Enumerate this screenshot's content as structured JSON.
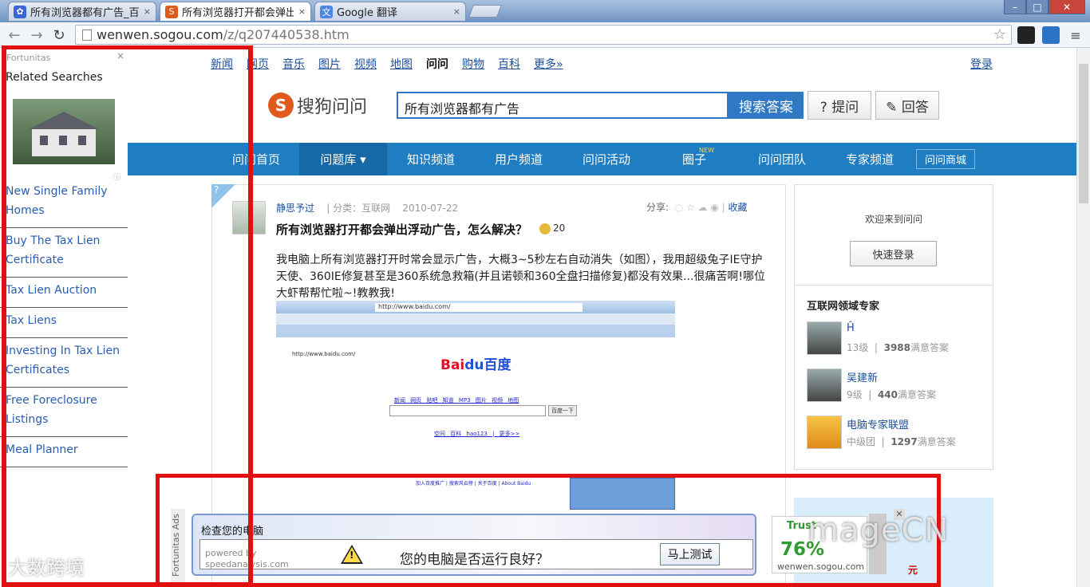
{
  "browser": {
    "tabs": [
      {
        "title": "所有浏览器都有广告_百度",
        "icon": "baidu-paw-icon",
        "close": "×"
      },
      {
        "title": "所有浏览器打开都会弹出",
        "icon": "sogou-icon",
        "close": "×"
      },
      {
        "title": "Google 翻译",
        "icon": "google-translate-icon",
        "close": "×"
      }
    ],
    "url_host": "wenwen.sogou.com",
    "url_path": "/z/q207440538.htm",
    "win_buttons": [
      "–",
      "□",
      "✕"
    ]
  },
  "sidebar": {
    "brand": "Fortunitas",
    "close": "×",
    "heading": "Related Searches",
    "adinfo": "ⓘ",
    "items": [
      "New Single Family Homes",
      "Buy The Tax Lien Certificate",
      "Tax Lien Auction",
      "Tax Liens",
      "Investing In Tax Lien Certificates",
      "Free Foreclosure Listings",
      "Meal Planner"
    ]
  },
  "topnav": {
    "items": [
      "新闻",
      "网页",
      "音乐",
      "图片",
      "视频",
      "地图",
      "问问",
      "购物",
      "百科",
      "更多»"
    ],
    "login": "登录"
  },
  "header": {
    "logo_letter": "S",
    "logo_text": "搜狗问问",
    "search_value": "所有浏览器都有广告",
    "search_button": "搜索答案",
    "ask_button": "? 提问",
    "answer_button": "✎ 回答"
  },
  "mainnav": {
    "items": [
      "问问首页",
      "问题库 ▾",
      "知识频道",
      "用户频道",
      "问问活动",
      "圈子",
      "问问团队",
      "专家频道"
    ],
    "new_badge": "NEW",
    "mall": "问问商城"
  },
  "question": {
    "corner": "?",
    "user": "静思予过",
    "category": "| 分类：互联网",
    "date": "2010-07-22",
    "share_label": "分享:",
    "collect": "收藏",
    "title": "所有浏览器打开都会弹出浮动广告，怎么解决？",
    "reward": "20",
    "body": "我电脑上所有浏览器打开时常会显示广告，大概3~5秒左右自动消失（如图），我用超级兔子IE守护天使、360IE修复甚至是360系统急救箱(并且诺顿和360全盘扫描修复)都没有效果...很痛苦啊!哪位大虾帮帮忙啦~!教教我!",
    "shot_address": "http://www.baidu.com/",
    "shot_tab": "http://www.baidu.com/",
    "shot_logo_a": "Bai",
    "shot_logo_b": "du百度",
    "shot_links": "新闻 网页 贴吧 知道 MP3 图片 视频 地图",
    "shot_button": "百度一下",
    "shot_foot": "空间 百科 hao123 | 更多>>",
    "shot_foot2": "加入百度推广 | 搜索风云榜 | 关于百度 | About Baidu"
  },
  "sidebox": {
    "welcome": "欢迎来到问问",
    "quick_login": "快速登录",
    "expert_heading": "互联网领域专家",
    "experts": [
      {
        "name": "Ĥ",
        "level": "13级",
        "answers": "3988",
        "suffix": "满意答案"
      },
      {
        "name": "吴建新",
        "level": "9级",
        "answers": "440",
        "suffix": "满意答案"
      },
      {
        "name": "电脑专家联盟",
        "level": "中级团",
        "answers": "1297",
        "suffix": "满意答案"
      }
    ]
  },
  "ad": {
    "label": "Fortunitas Ads",
    "head": "检查您的电脑",
    "powered": "powered by",
    "powered_site": "speedanalysis.com",
    "message": "您的电脑是否运行良好？",
    "button": "马上测试",
    "trust_title": "Trust",
    "trust_pct": "76%",
    "trust_domain": "wenwen.sogou.com",
    "close": "✕",
    "yuan": "元"
  },
  "watermarks": {
    "left": "大数跨境",
    "right": "mageCN"
  },
  "colors": {
    "accent": "#1f7dc2",
    "annotation": "#e01010",
    "sogou_orange": "#e05a1e"
  }
}
